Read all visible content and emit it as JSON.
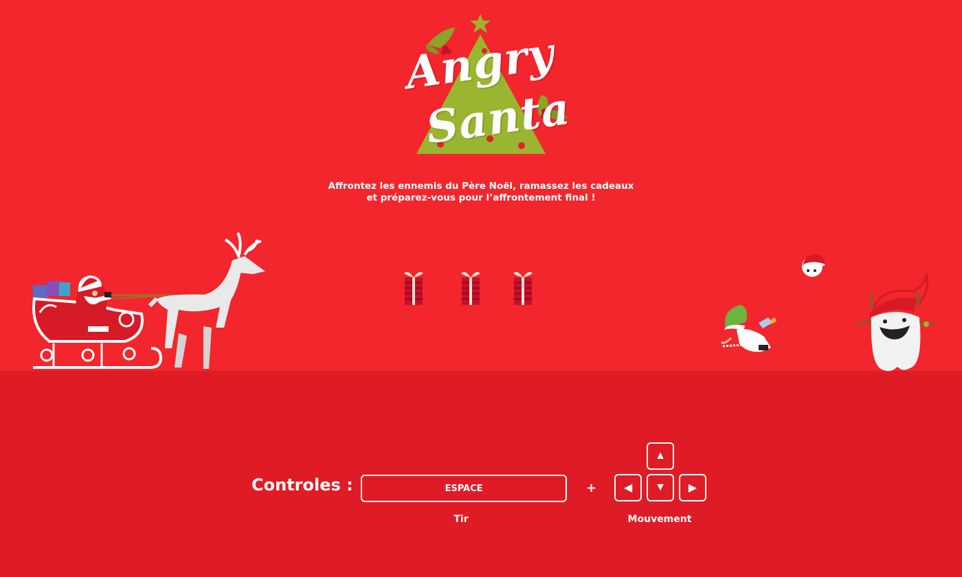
{
  "logo": {
    "line1": "Angry",
    "line2": "Santa"
  },
  "intro": {
    "line1": "Affrontez les ennemis du Père Noël,  ramassez les cadeaux",
    "line2": "et préparez-vous pour l’affrontement final !"
  },
  "lives": {
    "count": 3,
    "icon": "gift-icon"
  },
  "controls": {
    "label": "Controles :",
    "fire_key": "ESPACE",
    "plus": "+",
    "fire_caption": "Tir",
    "move_caption": "Mouvement",
    "arrows": {
      "up": "▲",
      "left": "◀",
      "down": "▼",
      "right": "▶"
    }
  },
  "colors": {
    "sky": "#f2262c",
    "ground": "#df1c25",
    "tree": "#9ab52f",
    "white": "#ffffff"
  }
}
